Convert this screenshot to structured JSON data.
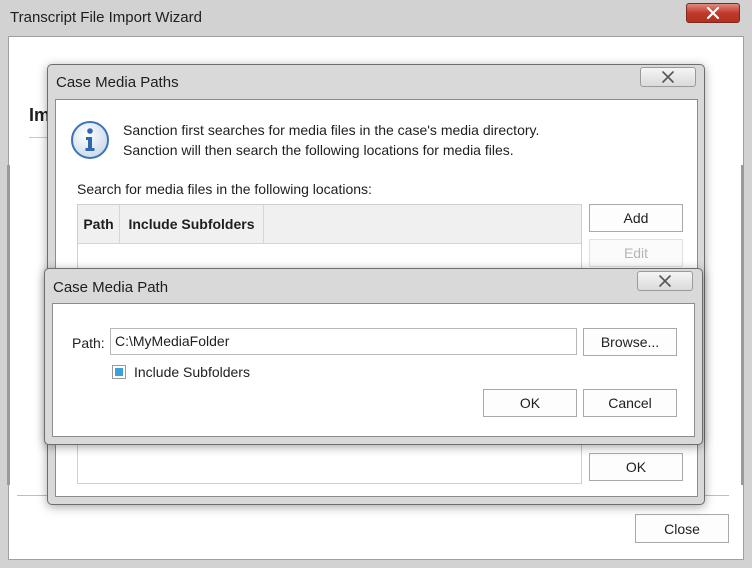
{
  "wizard": {
    "title": "Transcript File Import Wizard",
    "heading_partial": "Im",
    "close_label": "Close"
  },
  "media_paths": {
    "title": "Case Media Paths",
    "info_line1": "Sanction first searches for media files in the case's media directory.",
    "info_line2": "Sanction will then search the following locations for media files.",
    "search_label": "Search for media files in the following locations:",
    "columns": [
      "Path",
      "Include Subfolders"
    ],
    "add_label": "Add",
    "edit_label": "Edit",
    "ok_label": "OK"
  },
  "media_path": {
    "title": "Case Media Path",
    "path_label": "Path:",
    "path_value": "C:\\MyMediaFolder",
    "browse_label": "Browse...",
    "include_label": "Include Subfolders",
    "include_checked": true,
    "ok_label": "OK",
    "cancel_label": "Cancel"
  },
  "colors": {
    "checkbox_fill": "#3ba1dc",
    "close_red": "#c0392b",
    "info_icon": "#3c74b8"
  },
  "icons": [
    "close-icon",
    "info-icon",
    "checkbox-icon"
  ]
}
